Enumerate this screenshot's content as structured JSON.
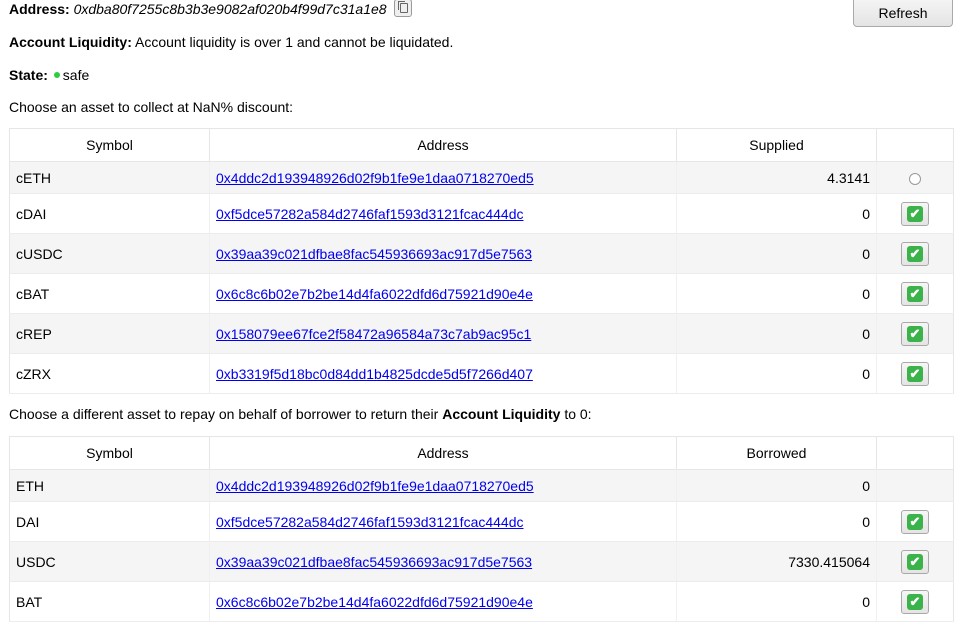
{
  "account": {
    "address_label": "Address:",
    "address_value": "0xdba80f7255c8b3b3e9082af020b4f99d7c31a1e8",
    "liquidity_label": "Account Liquidity:",
    "liquidity_text": "Account liquidity is over 1 and cannot be liquidated.",
    "state_label": "State:",
    "state_value": "safe",
    "state_color": "#2ecc40"
  },
  "toolbar": {
    "refresh_label": "Refresh",
    "copy_icon": "copy-icon"
  },
  "collect": {
    "prompt": "Choose an asset to collect at NaN% discount:",
    "headers": [
      "Symbol",
      "Address",
      "Supplied",
      ""
    ],
    "rows": [
      {
        "symbol": "cETH",
        "address": "0x4ddc2d193948926d02f9b1fe9e1daa0718270ed5",
        "amount": "4.3141",
        "control": "radio"
      },
      {
        "symbol": "cDAI",
        "address": "0xf5dce57282a584d2746faf1593d3121fcac444dc",
        "amount": "0",
        "control": "check"
      },
      {
        "symbol": "cUSDC",
        "address": "0x39aa39c021dfbae8fac545936693ac917d5e7563",
        "amount": "0",
        "control": "check"
      },
      {
        "symbol": "cBAT",
        "address": "0x6c8c6b02e7b2be14d4fa6022dfd6d75921d90e4e",
        "amount": "0",
        "control": "check"
      },
      {
        "symbol": "cREP",
        "address": "0x158079ee67fce2f58472a96584a73c7ab9ac95c1",
        "amount": "0",
        "control": "check"
      },
      {
        "symbol": "cZRX",
        "address": "0xb3319f5d18bc0d84dd1b4825dcde5d5f7266d407",
        "amount": "0",
        "control": "check"
      }
    ]
  },
  "repay": {
    "prompt_before": "Choose a different asset to repay on behalf of borrower to return their ",
    "prompt_bold": "Account Liquidity",
    "prompt_after": " to 0:",
    "headers": [
      "Symbol",
      "Address",
      "Borrowed",
      ""
    ],
    "rows": [
      {
        "symbol": "ETH",
        "address": "0x4ddc2d193948926d02f9b1fe9e1daa0718270ed5",
        "amount": "0",
        "control": "none"
      },
      {
        "symbol": "DAI",
        "address": "0xf5dce57282a584d2746faf1593d3121fcac444dc",
        "amount": "0",
        "control": "check"
      },
      {
        "symbol": "USDC",
        "address": "0x39aa39c021dfbae8fac545936693ac917d5e7563",
        "amount": "7330.415064",
        "control": "check"
      },
      {
        "symbol": "BAT",
        "address": "0x6c8c6b02e7b2be14d4fa6022dfd6d75921d90e4e",
        "amount": "0",
        "control": "check"
      }
    ]
  }
}
